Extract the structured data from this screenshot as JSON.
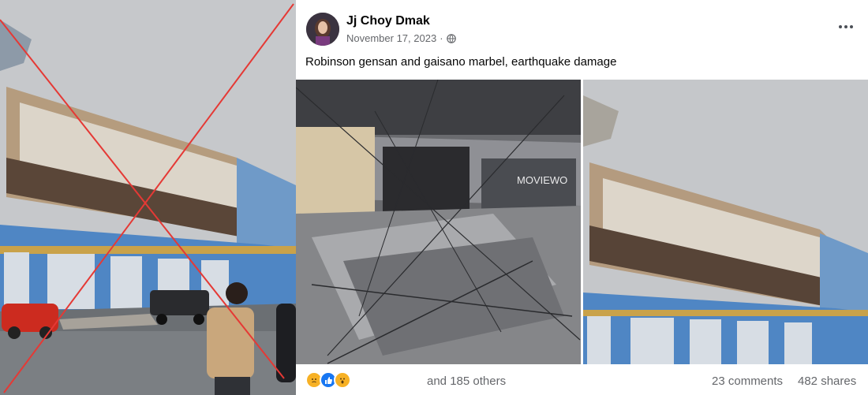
{
  "post": {
    "author": "Jj Choy Dmak",
    "date": "November 17, 2023",
    "separator": "·",
    "caption": "Robinson gensan and gaisano marbel, earthquake damage",
    "photo_text": "MOVIEWO",
    "reactions": [
      "sad-icon",
      "like-icon",
      "wow-icon"
    ],
    "reaction_others": "and 185 others",
    "comments": "23 comments",
    "shares": "482 shares"
  },
  "colors": {
    "cross": "#e53935",
    "name": "#050505",
    "meta": "#65676b",
    "like": "#1877f2",
    "emoji": "#f7b125"
  }
}
